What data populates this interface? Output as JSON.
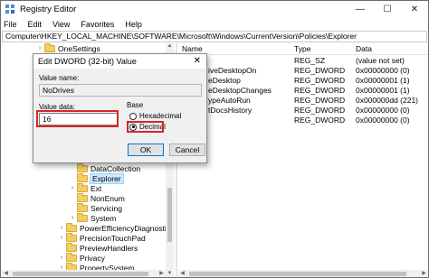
{
  "window": {
    "title": "Registry Editor",
    "controls": {
      "minimize": "—",
      "maximize": "☐",
      "close": "✕"
    }
  },
  "menu": [
    "File",
    "Edit",
    "View",
    "Favorites",
    "Help"
  ],
  "address": "Computer\\HKEY_LOCAL_MACHINE\\SOFTWARE\\Microsoft\\Windows\\CurrentVersion\\Policies\\Explorer",
  "tree": {
    "items": [
      {
        "label": "OneSettings",
        "expander": "›"
      },
      {
        "label": "DataCollection",
        "expander": ""
      },
      {
        "label": "Explorer",
        "expander": "",
        "selected": true
      },
      {
        "label": "Ext",
        "expander": "›"
      },
      {
        "label": "NonEnum",
        "expander": ""
      },
      {
        "label": "Servicing",
        "expander": ""
      },
      {
        "label": "System",
        "expander": "›"
      },
      {
        "label": "PowerEfficiencyDiagnostics",
        "expander": "›"
      },
      {
        "label": "PrecisionTouchPad",
        "expander": "›"
      },
      {
        "label": "PreviewHandlers",
        "expander": ""
      },
      {
        "label": "Privacy",
        "expander": "›"
      },
      {
        "label": "PropertySystem",
        "expander": "›"
      }
    ]
  },
  "list": {
    "headers": {
      "name": "Name",
      "type": "Type",
      "data": "Data"
    },
    "rows": [
      {
        "name": "",
        "type": "REG_SZ",
        "data": "(value not set)"
      },
      {
        "name": "iveDesktopOn",
        "type": "REG_DWORD",
        "data": "0x00000000 (0)"
      },
      {
        "name": "eDesktop",
        "type": "REG_DWORD",
        "data": "0x00000001 (1)"
      },
      {
        "name": "eDesktopChanges",
        "type": "REG_DWORD",
        "data": "0x00000001 (1)"
      },
      {
        "name": "ypeAutoRun",
        "type": "REG_DWORD",
        "data": "0x000000dd (221)"
      },
      {
        "name": "tDocsHistory",
        "type": "REG_DWORD",
        "data": "0x00000000 (0)"
      },
      {
        "name": "",
        "type": "REG_DWORD",
        "data": "0x00000000 (0)"
      }
    ]
  },
  "dialog": {
    "title": "Edit DWORD (32-bit) Value",
    "close": "✕",
    "value_name_label": "Value name:",
    "value_name": "NoDrives",
    "value_data_label": "Value data:",
    "value_data": "16",
    "base_label": "Base",
    "radio_hex": "Hexadecimal",
    "radio_dec": "Decimal",
    "selected_base": "Decimal",
    "ok": "OK",
    "cancel": "Cancel"
  },
  "colors": {
    "highlight": "#d6262b",
    "selection": "#cce8ff",
    "folder": "#f3cf62"
  }
}
